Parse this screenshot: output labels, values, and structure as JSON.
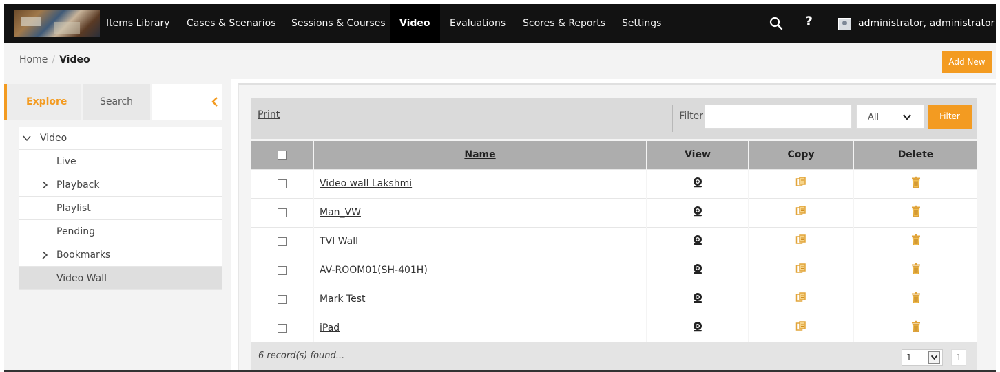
{
  "nav": {
    "items": [
      "Items Library",
      "Cases & Scenarios",
      "Sessions & Courses",
      "Video",
      "Evaluations",
      "Scores & Reports",
      "Settings"
    ],
    "active": "Video",
    "help": "?",
    "user": "administrator, administrator"
  },
  "breadcrumb": {
    "home": "Home",
    "separator": "/",
    "current": "Video"
  },
  "actions": {
    "add_new": "Add New"
  },
  "sidebar": {
    "tabs": {
      "explore": "Explore",
      "search": "Search"
    },
    "tree": [
      {
        "label": "Video",
        "icon": "chevron-down-icon"
      },
      {
        "label": "Live"
      },
      {
        "label": "Playback",
        "icon": "chevron-right-icon"
      },
      {
        "label": "Playlist"
      },
      {
        "label": "Pending"
      },
      {
        "label": "Bookmarks",
        "icon": "chevron-right-icon"
      },
      {
        "label": "Video Wall",
        "selected": true
      }
    ]
  },
  "toolbar": {
    "print": "Print",
    "filter_label": "Filter",
    "filter_value": "",
    "filter_select": "All",
    "filter_button": "Filter"
  },
  "table": {
    "headers": {
      "name": "Name",
      "view": "View",
      "copy": "Copy",
      "delete": "Delete"
    },
    "rows": [
      "Video wall Lakshmi",
      "Man_VW",
      "TVI Wall",
      "AV-ROOM01(SH-401H)",
      "Mark Test",
      "iPad"
    ]
  },
  "footer": {
    "records": "6 record(s) found...",
    "page_select": "1",
    "page_total": "1"
  },
  "colors": {
    "accent": "#f39b21",
    "nav_bg": "#121212",
    "header_bg": "#adadad",
    "toolbar_bg": "#dadada"
  }
}
